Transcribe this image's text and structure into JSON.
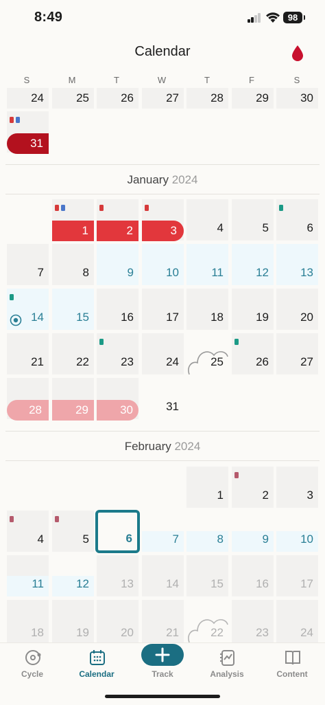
{
  "status": {
    "time": "8:49",
    "battery": "98"
  },
  "header": {
    "title": "Calendar"
  },
  "weekdays": [
    "S",
    "M",
    "T",
    "W",
    "T",
    "F",
    "S"
  ],
  "december_partial": {
    "days": [
      "24",
      "25",
      "26",
      "27",
      "28",
      "29",
      "30",
      "31"
    ]
  },
  "january": {
    "month": "January",
    "year": "2024",
    "days": [
      "1",
      "2",
      "3",
      "4",
      "5",
      "6",
      "7",
      "8",
      "9",
      "10",
      "11",
      "12",
      "13",
      "14",
      "15",
      "16",
      "17",
      "18",
      "19",
      "20",
      "21",
      "22",
      "23",
      "24",
      "25",
      "26",
      "27",
      "28",
      "29",
      "30",
      "31"
    ]
  },
  "february": {
    "month": "February",
    "year": "2024",
    "days": [
      "1",
      "2",
      "3",
      "4",
      "5",
      "6",
      "7",
      "8",
      "9",
      "10",
      "11",
      "12",
      "13",
      "14",
      "15",
      "16",
      "17",
      "18",
      "19",
      "20",
      "21",
      "22",
      "23",
      "24"
    ]
  },
  "nav": {
    "items": [
      {
        "label": "Cycle",
        "icon": "cycle-icon"
      },
      {
        "label": "Calendar",
        "icon": "calendar-icon"
      },
      {
        "label": "Track",
        "icon": "plus-icon"
      },
      {
        "label": "Analysis",
        "icon": "analysis-icon"
      },
      {
        "label": "Content",
        "icon": "book-icon"
      }
    ]
  },
  "colors": {
    "accent": "#1b6e82",
    "period_dark": "#b3111e",
    "period": "#e2373c",
    "period_predicted": "#efa6aa",
    "fertile_bg": "#eef8fc",
    "marker_teal": "#1c9a86",
    "marker_blue": "#4a76c9"
  }
}
